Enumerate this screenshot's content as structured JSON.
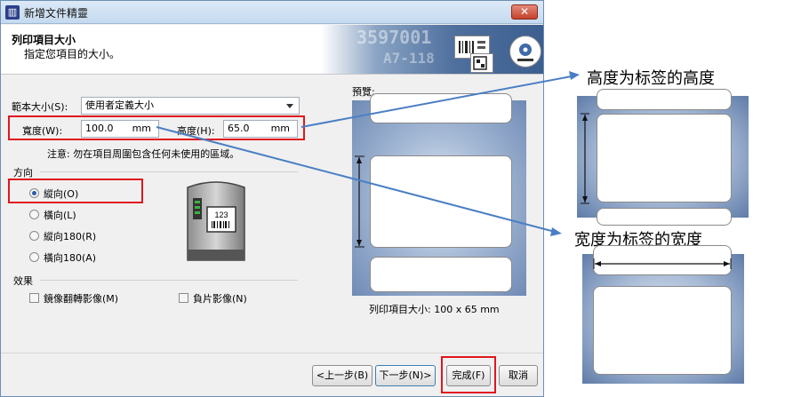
{
  "window": {
    "title": "新增文件精靈",
    "app_icon": "label-app-icon",
    "close": "✕"
  },
  "header": {
    "title": "列印項目大小",
    "subtitle": "指定您項目的大小。",
    "art_text_1": "3597001",
    "art_text_2": "A7-118"
  },
  "form": {
    "template_label": "範本大小(S):",
    "template_value": "使用者定義大小",
    "width_label": "寬度(W):",
    "width_value": "100.0",
    "width_unit": "mm",
    "height_label": "高度(H):",
    "height_value": "65.0",
    "height_unit": "mm",
    "note": "注意: 勿在項目周圍包含任何未使用的區域。"
  },
  "orientation": {
    "group_label": "方向",
    "options": [
      {
        "label": "縱向(O)",
        "checked": true
      },
      {
        "label": "橫向(L)",
        "checked": false
      },
      {
        "label": "縱向180(R)",
        "checked": false
      },
      {
        "label": "橫向180(A)",
        "checked": false
      }
    ]
  },
  "effects": {
    "group_label": "效果",
    "mirror": "鏡像翻轉影像(M)",
    "negative": "負片影像(N)"
  },
  "printer": {
    "display_text": "123"
  },
  "preview": {
    "label": "預覽:",
    "size_text": "列印項目大小: 100 x 65 mm"
  },
  "buttons": {
    "back": "<上一步(B)",
    "next": "下一步(N)>",
    "finish": "完成(F)",
    "cancel": "取消"
  },
  "annotations": {
    "height_note": "高度为标签的高度",
    "width_note": "宽度为标签的宽度"
  },
  "colors": {
    "highlight": "#e0161e",
    "arrow": "#4a7fc4"
  }
}
